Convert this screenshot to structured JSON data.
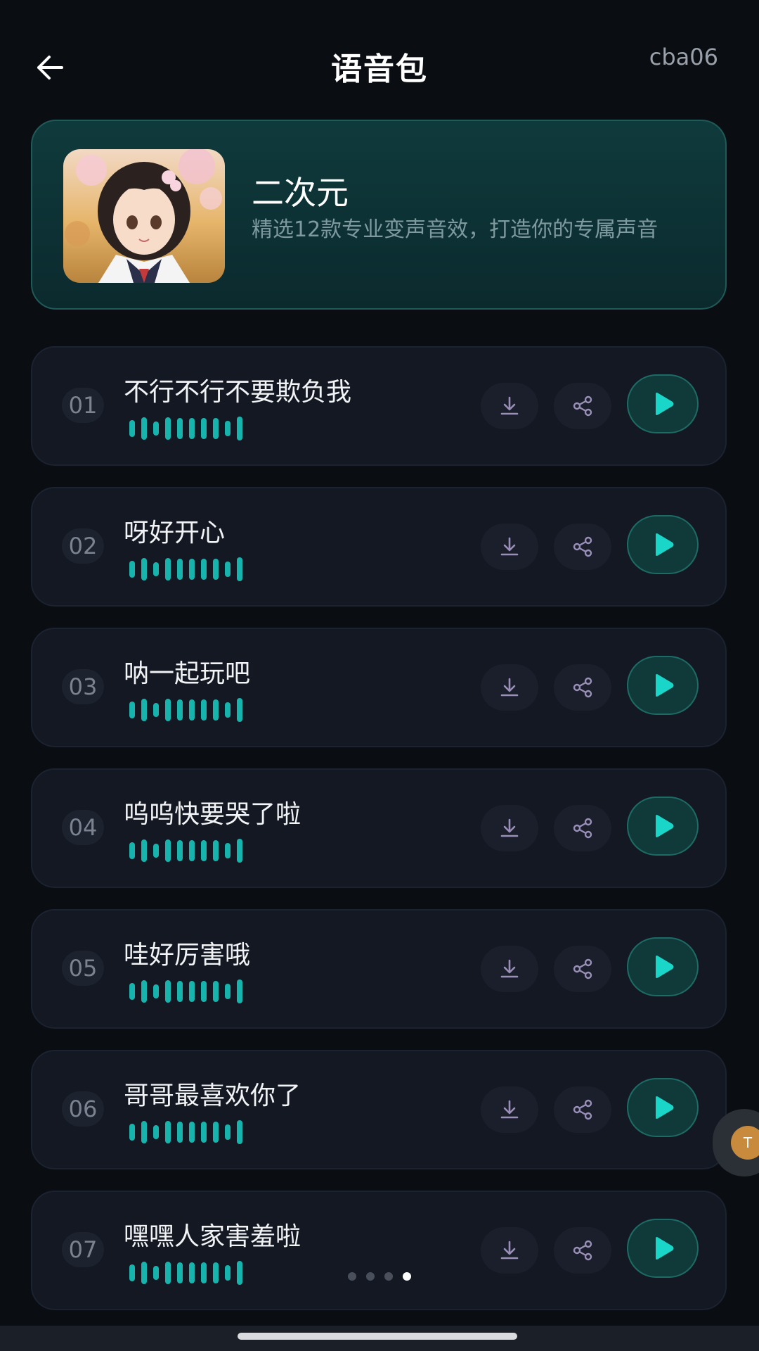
{
  "header": {
    "title": "语音包",
    "user": "cba06"
  },
  "pack": {
    "name": "二次元",
    "description": "精选12款专业变声音效，打造你的专属声音"
  },
  "tracks": [
    {
      "number": "01",
      "title": "不行不行不要欺负我"
    },
    {
      "number": "02",
      "title": "呀好开心"
    },
    {
      "number": "03",
      "title": "呐一起玩吧"
    },
    {
      "number": "04",
      "title": "呜呜快要哭了啦"
    },
    {
      "number": "05",
      "title": "哇好厉害哦"
    },
    {
      "number": "06",
      "title": "哥哥最喜欢你了"
    },
    {
      "number": "07",
      "title": "嘿嘿人家害羞啦"
    }
  ],
  "pagination": {
    "count": 4,
    "active_index": 3
  },
  "float_widget": {
    "label": "T"
  },
  "colors": {
    "accent": "#17b3ad",
    "play_icon": "#19d6c8",
    "card_bg": "#131823",
    "pack_bg": "#0f3a3c"
  },
  "icons": {
    "back": "arrow-left-icon",
    "download": "download-icon",
    "share": "share-icon",
    "play": "play-icon",
    "waveform": "waveform-icon"
  }
}
